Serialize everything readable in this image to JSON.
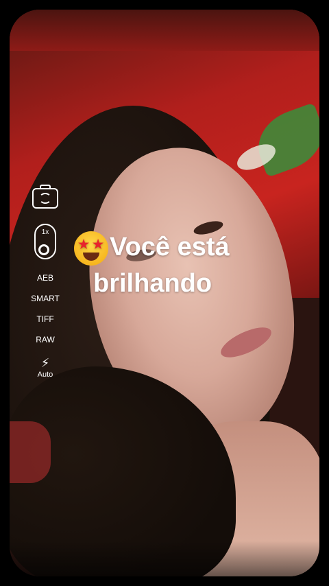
{
  "camera_controls": {
    "zoom_label": "1x",
    "modes": [
      "AEB",
      "SMART",
      "TIFF",
      "RAW"
    ],
    "flash_label": "Auto"
  },
  "icons": {
    "flip": "camera-flip-icon",
    "flash": "lightning-icon",
    "emoji": "star-struck-emoji-icon"
  },
  "caption": {
    "line1": "Você está",
    "line2": "brilhando"
  }
}
